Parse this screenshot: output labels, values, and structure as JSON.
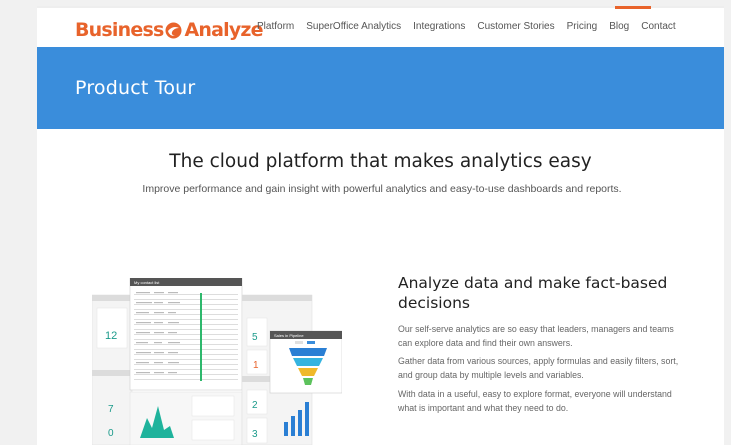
{
  "header": {
    "logo": {
      "word1": "Business",
      "word2": "Analyze"
    },
    "nav": [
      "Platform",
      "SuperOffice Analytics",
      "Integrations",
      "Customer Stories",
      "Pricing",
      "Blog",
      "Contact"
    ]
  },
  "banner": {
    "title": "Product Tour"
  },
  "hero": {
    "title": "The cloud platform that makes analytics easy",
    "subtitle": "Improve performance and gain insight with powerful analytics and easy-to-use dashboards and reports."
  },
  "feature": {
    "title": "Analyze data and make fact-based decisions",
    "paragraphs": [
      "Our self-serve analytics are so easy that leaders, managers and teams can explore data and find their own answers.",
      "Gather data from various sources, apply formulas and easily filters, sort, and group data by multiple levels and variables.",
      "With data in a useful, easy to explore format, everyone will understand what is important and what they need to do."
    ]
  },
  "dashboard": {
    "contact_list_title": "My contact list",
    "pipeline_title": "Sales in Pipeline",
    "kpis": [
      "7",
      "0",
      "12",
      "5",
      "1",
      "2",
      "3"
    ]
  },
  "colors": {
    "brand": "#e8632b",
    "banner": "#3a8ddb"
  }
}
